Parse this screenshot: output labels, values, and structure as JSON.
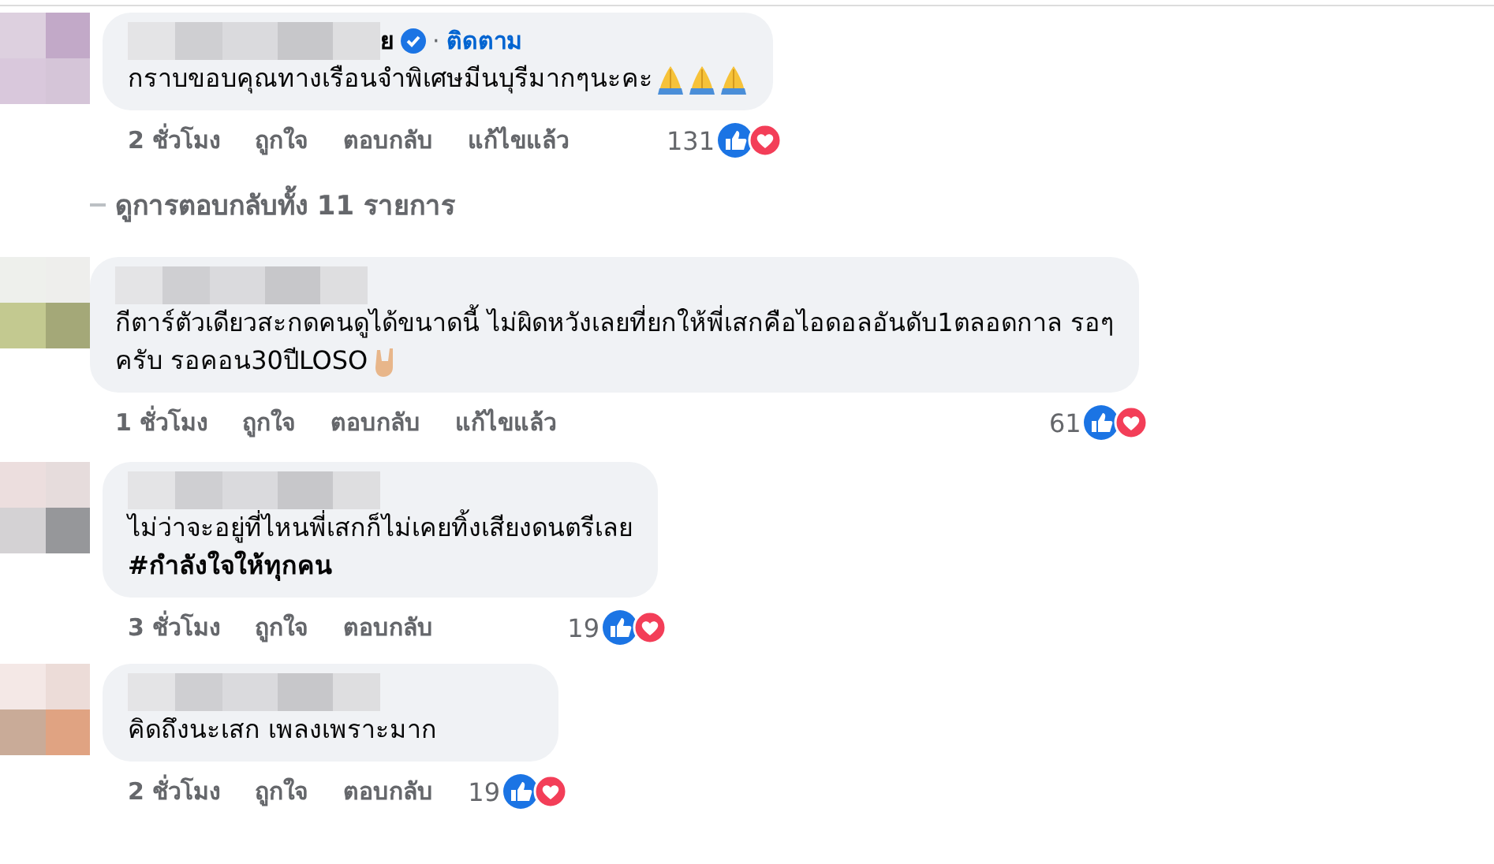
{
  "comments": [
    {
      "author_visible": "ย",
      "verified": true,
      "separator": "·",
      "follow": "ติดตาม",
      "lines": [
        "กราบขอบคุณทางเรือนจำพิเศษมีนบุรีมากๆนะคะ"
      ],
      "emojis": [
        {
          "kind": "pray"
        },
        {
          "kind": "pray"
        },
        {
          "kind": "pray"
        }
      ],
      "time": "2 ชั่วโมง",
      "like": "ถูกใจ",
      "reply": "ตอบกลับ",
      "edited": "แก้ไขแล้ว",
      "reaction_count": "131",
      "reactions": [
        {
          "kind": "like"
        },
        {
          "kind": "love"
        }
      ],
      "view_replies": "ดูการตอบกลับทั้ง 11 รายการ"
    },
    {
      "lines": [
        "กีตาร์ตัวเดียวสะกดคนดูได้ขนาดนี้ ไม่ผิดหวังเลยที่ยกให้พี่เสกคือไอดอลอันดับ1ตลอดกาล รอๆ",
        "ครับ รอคอน30ปีLOSO"
      ],
      "emojis": [
        {
          "kind": "rock"
        }
      ],
      "time": "1 ชั่วโมง",
      "like": "ถูกใจ",
      "reply": "ตอบกลับ",
      "edited": "แก้ไขแล้ว",
      "reaction_count": "61",
      "reactions": [
        {
          "kind": "like"
        },
        {
          "kind": "love"
        }
      ]
    },
    {
      "lines": [
        "ไม่ว่าจะอยู่ที่ไหนพี่เสกก็ไม่เคยทิ้งเสียงดนตรีเลย"
      ],
      "hashtag": "#กำลังใจให้ทุกคน",
      "time": "3 ชั่วโมง",
      "like": "ถูกใจ",
      "reply": "ตอบกลับ",
      "reaction_count": "19",
      "reactions": [
        {
          "kind": "like"
        },
        {
          "kind": "love"
        }
      ]
    },
    {
      "lines": [
        "คิดถึงนะเสก เพลงเพราะมาก"
      ],
      "time": "2 ชั่วโมง",
      "like": "ถูกใจ",
      "reply": "ตอบกลับ",
      "reaction_count": "19",
      "reactions": [
        {
          "kind": "like"
        },
        {
          "kind": "love"
        }
      ]
    }
  ]
}
